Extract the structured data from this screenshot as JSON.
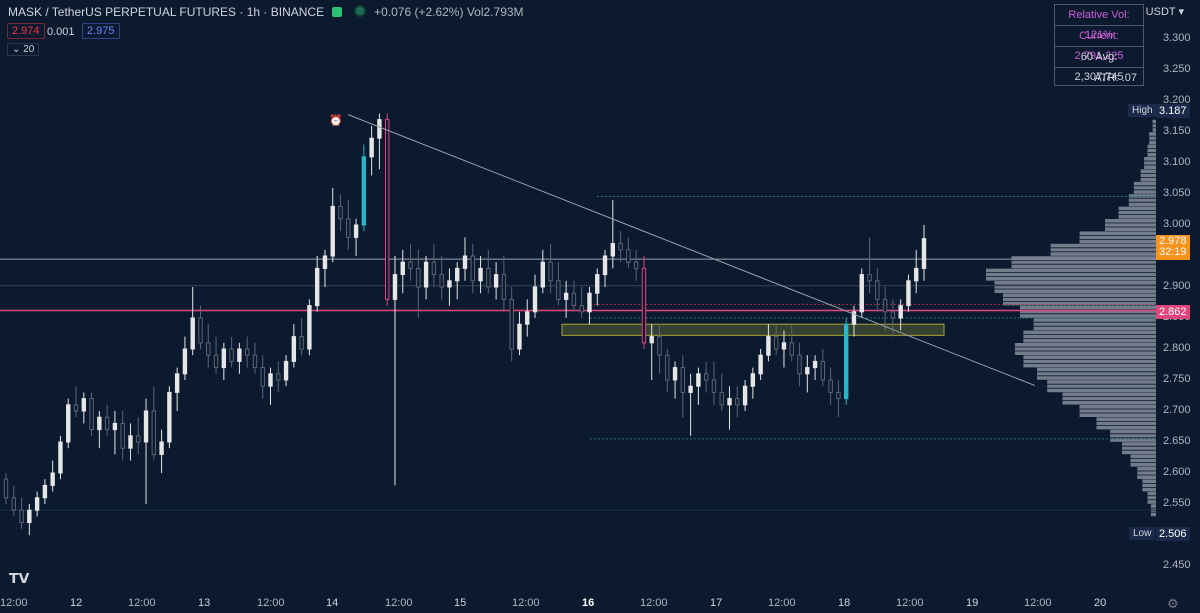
{
  "header": {
    "symbol": "MASK / TetherUS PERPETUAL FUTURES · 1h · BINANCE",
    "change": "+0.076 (+2.62%)",
    "vol_label": "Vol",
    "vol_value": "2.793M",
    "bid": "2.974",
    "spread": "0.001",
    "ask": "2.975",
    "indicator": "20"
  },
  "indicator_box": {
    "relative_vol": "Relative Vol: 121%",
    "current": "Current: 2,791,225",
    "avg": "60 Avg: 2,307,745",
    "atr": "ATR: .07"
  },
  "axis": {
    "currency": "USDT",
    "ticks": [
      "3.300",
      "3.250",
      "3.200",
      "3.150",
      "3.100",
      "3.050",
      "3.000",
      "2.950",
      "2.900",
      "2.850",
      "2.800",
      "2.750",
      "2.700",
      "2.650",
      "2.600",
      "2.550",
      "2.450"
    ],
    "x_labels": [
      "12:00",
      "12",
      "12:00",
      "13",
      "12:00",
      "14",
      "12:00",
      "15",
      "12:00",
      "16",
      "12:00",
      "17",
      "12:00",
      "18",
      "12:00",
      "19",
      "12:00",
      "20"
    ]
  },
  "badges": {
    "high_label": "High",
    "high_value": "3.187",
    "low_label": "Low",
    "low_value": "2.506",
    "current_price": "2.978",
    "countdown": "32:19",
    "red_line": "2.862"
  },
  "colors": {
    "background": "#0b1a2f",
    "up": "#e6e6e6",
    "down": "#5d6373",
    "bull_hl": "#26b5c9",
    "bear_hl": "#e0457b",
    "red_line": "#e0457b",
    "price_badge": "#f7931a",
    "zone": "#a7a436"
  },
  "chart_data": {
    "type": "candlestick",
    "price_range": [
      2.42,
      3.33
    ],
    "high": 3.187,
    "low": 2.506,
    "last": 2.978,
    "levels": {
      "white_line": 2.945,
      "red_line": 2.862,
      "faint_line": 2.902,
      "dotted_red": 2.872,
      "dotted_teal": 2.85,
      "top_teal": 3.046,
      "bottom_teal": 2.655,
      "supply_zone": [
        2.822,
        2.84
      ]
    },
    "trendline": {
      "from": [
        348,
        3.178
      ],
      "to": [
        1035,
        2.741
      ]
    },
    "candles": [
      [
        2.59,
        2.6,
        2.55,
        2.56
      ],
      [
        2.56,
        2.58,
        2.53,
        2.54
      ],
      [
        2.54,
        2.56,
        2.51,
        2.52
      ],
      [
        2.52,
        2.55,
        2.5,
        2.54
      ],
      [
        2.54,
        2.57,
        2.53,
        2.56
      ],
      [
        2.56,
        2.59,
        2.55,
        2.58
      ],
      [
        2.58,
        2.62,
        2.57,
        2.6
      ],
      [
        2.6,
        2.66,
        2.59,
        2.65
      ],
      [
        2.65,
        2.72,
        2.64,
        2.71
      ],
      [
        2.71,
        2.74,
        2.69,
        2.7
      ],
      [
        2.7,
        2.73,
        2.68,
        2.72
      ],
      [
        2.72,
        2.73,
        2.66,
        2.67
      ],
      [
        2.67,
        2.7,
        2.64,
        2.69
      ],
      [
        2.69,
        2.71,
        2.66,
        2.67
      ],
      [
        2.67,
        2.7,
        2.63,
        2.68
      ],
      [
        2.68,
        2.7,
        2.62,
        2.64
      ],
      [
        2.64,
        2.68,
        2.62,
        2.66
      ],
      [
        2.66,
        2.69,
        2.63,
        2.65
      ],
      [
        2.65,
        2.72,
        2.55,
        2.7
      ],
      [
        2.7,
        2.74,
        2.62,
        2.63
      ],
      [
        2.63,
        2.67,
        2.6,
        2.65
      ],
      [
        2.65,
        2.74,
        2.64,
        2.73
      ],
      [
        2.73,
        2.77,
        2.7,
        2.76
      ],
      [
        2.76,
        2.82,
        2.75,
        2.8
      ],
      [
        2.8,
        2.9,
        2.79,
        2.85
      ],
      [
        2.85,
        2.87,
        2.8,
        2.81
      ],
      [
        2.81,
        2.84,
        2.77,
        2.79
      ],
      [
        2.79,
        2.82,
        2.76,
        2.77
      ],
      [
        2.77,
        2.81,
        2.75,
        2.8
      ],
      [
        2.8,
        2.82,
        2.77,
        2.78
      ],
      [
        2.78,
        2.81,
        2.76,
        2.8
      ],
      [
        2.8,
        2.82,
        2.77,
        2.79
      ],
      [
        2.79,
        2.81,
        2.76,
        2.77
      ],
      [
        2.77,
        2.79,
        2.72,
        2.74
      ],
      [
        2.74,
        2.77,
        2.71,
        2.76
      ],
      [
        2.76,
        2.78,
        2.73,
        2.75
      ],
      [
        2.75,
        2.79,
        2.74,
        2.78
      ],
      [
        2.78,
        2.84,
        2.77,
        2.82
      ],
      [
        2.82,
        2.85,
        2.79,
        2.8
      ],
      [
        2.8,
        2.88,
        2.79,
        2.87
      ],
      [
        2.87,
        2.95,
        2.86,
        2.93
      ],
      [
        2.93,
        2.96,
        2.9,
        2.95
      ],
      [
        2.95,
        3.06,
        2.94,
        3.03
      ],
      [
        3.03,
        3.05,
        2.99,
        3.01
      ],
      [
        3.01,
        3.04,
        2.96,
        2.98
      ],
      [
        2.98,
        3.01,
        2.95,
        3.0
      ],
      [
        3.0,
        3.13,
        2.99,
        3.11
      ],
      [
        3.11,
        3.16,
        3.08,
        3.14
      ],
      [
        3.14,
        3.18,
        3.09,
        3.17
      ],
      [
        3.17,
        3.18,
        2.87,
        2.88
      ],
      [
        2.88,
        2.95,
        2.58,
        2.92
      ],
      [
        2.92,
        2.96,
        2.89,
        2.94
      ],
      [
        2.94,
        2.97,
        2.91,
        2.93
      ],
      [
        2.93,
        2.96,
        2.85,
        2.9
      ],
      [
        2.9,
        2.95,
        2.88,
        2.94
      ],
      [
        2.94,
        2.97,
        2.9,
        2.92
      ],
      [
        2.92,
        2.95,
        2.88,
        2.9
      ],
      [
        2.9,
        2.93,
        2.87,
        2.91
      ],
      [
        2.91,
        2.94,
        2.88,
        2.93
      ],
      [
        2.93,
        2.98,
        2.91,
        2.95
      ],
      [
        2.95,
        2.97,
        2.89,
        2.91
      ],
      [
        2.91,
        2.95,
        2.89,
        2.93
      ],
      [
        2.93,
        2.96,
        2.89,
        2.9
      ],
      [
        2.9,
        2.94,
        2.88,
        2.92
      ],
      [
        2.92,
        2.95,
        2.86,
        2.88
      ],
      [
        2.88,
        2.9,
        2.78,
        2.8
      ],
      [
        2.8,
        2.86,
        2.79,
        2.84
      ],
      [
        2.84,
        2.88,
        2.82,
        2.86
      ],
      [
        2.86,
        2.92,
        2.85,
        2.9
      ],
      [
        2.9,
        2.96,
        2.89,
        2.94
      ],
      [
        2.94,
        2.97,
        2.89,
        2.91
      ],
      [
        2.91,
        2.94,
        2.87,
        2.88
      ],
      [
        2.88,
        2.91,
        2.85,
        2.89
      ],
      [
        2.89,
        2.91,
        2.86,
        2.87
      ],
      [
        2.87,
        2.9,
        2.85,
        2.86
      ],
      [
        2.86,
        2.9,
        2.84,
        2.89
      ],
      [
        2.89,
        2.93,
        2.87,
        2.92
      ],
      [
        2.92,
        2.96,
        2.9,
        2.95
      ],
      [
        2.95,
        3.04,
        2.93,
        2.97
      ],
      [
        2.97,
        2.99,
        2.94,
        2.96
      ],
      [
        2.96,
        2.98,
        2.93,
        2.94
      ],
      [
        2.94,
        2.96,
        2.91,
        2.93
      ],
      [
        2.93,
        2.95,
        2.8,
        2.81
      ],
      [
        2.81,
        2.84,
        2.75,
        2.82
      ],
      [
        2.82,
        2.84,
        2.76,
        2.79
      ],
      [
        2.79,
        2.8,
        2.73,
        2.75
      ],
      [
        2.75,
        2.78,
        2.72,
        2.77
      ],
      [
        2.77,
        2.79,
        2.69,
        2.73
      ],
      [
        2.73,
        2.76,
        2.66,
        2.74
      ],
      [
        2.74,
        2.77,
        2.71,
        2.76
      ],
      [
        2.76,
        2.78,
        2.73,
        2.75
      ],
      [
        2.75,
        2.78,
        2.71,
        2.73
      ],
      [
        2.73,
        2.76,
        2.7,
        2.71
      ],
      [
        2.71,
        2.74,
        2.67,
        2.72
      ],
      [
        2.72,
        2.74,
        2.69,
        2.71
      ],
      [
        2.71,
        2.75,
        2.7,
        2.74
      ],
      [
        2.74,
        2.77,
        2.72,
        2.76
      ],
      [
        2.76,
        2.8,
        2.75,
        2.79
      ],
      [
        2.79,
        2.84,
        2.78,
        2.82
      ],
      [
        2.82,
        2.84,
        2.79,
        2.8
      ],
      [
        2.8,
        2.83,
        2.77,
        2.81
      ],
      [
        2.81,
        2.84,
        2.78,
        2.79
      ],
      [
        2.79,
        2.81,
        2.74,
        2.76
      ],
      [
        2.76,
        2.79,
        2.73,
        2.77
      ],
      [
        2.77,
        2.79,
        2.75,
        2.78
      ],
      [
        2.78,
        2.8,
        2.74,
        2.75
      ],
      [
        2.75,
        2.77,
        2.71,
        2.73
      ],
      [
        2.73,
        2.75,
        2.69,
        2.72
      ],
      [
        2.72,
        2.85,
        2.71,
        2.84
      ],
      [
        2.84,
        2.87,
        2.82,
        2.86
      ],
      [
        2.86,
        2.93,
        2.85,
        2.92
      ],
      [
        2.92,
        2.98,
        2.89,
        2.91
      ],
      [
        2.91,
        2.93,
        2.86,
        2.88
      ],
      [
        2.88,
        2.9,
        2.83,
        2.86
      ],
      [
        2.86,
        2.88,
        2.82,
        2.85
      ],
      [
        2.85,
        2.88,
        2.83,
        2.87
      ],
      [
        2.87,
        2.92,
        2.86,
        2.91
      ],
      [
        2.91,
        2.96,
        2.89,
        2.93
      ],
      [
        2.93,
        3.0,
        2.91,
        2.978
      ]
    ],
    "volume_profile": [
      [
        3.16,
        0.02
      ],
      [
        3.14,
        0.04
      ],
      [
        3.12,
        0.05
      ],
      [
        3.1,
        0.07
      ],
      [
        3.08,
        0.09
      ],
      [
        3.06,
        0.13
      ],
      [
        3.04,
        0.16
      ],
      [
        3.02,
        0.22
      ],
      [
        3.0,
        0.3
      ],
      [
        2.98,
        0.45
      ],
      [
        2.96,
        0.62
      ],
      [
        2.94,
        0.85
      ],
      [
        2.92,
        1.0
      ],
      [
        2.9,
        0.95
      ],
      [
        2.88,
        0.9
      ],
      [
        2.86,
        0.8
      ],
      [
        2.84,
        0.72
      ],
      [
        2.82,
        0.78
      ],
      [
        2.8,
        0.83
      ],
      [
        2.78,
        0.78
      ],
      [
        2.76,
        0.7
      ],
      [
        2.74,
        0.64
      ],
      [
        2.72,
        0.55
      ],
      [
        2.7,
        0.45
      ],
      [
        2.68,
        0.35
      ],
      [
        2.66,
        0.27
      ],
      [
        2.64,
        0.2
      ],
      [
        2.62,
        0.15
      ],
      [
        2.6,
        0.11
      ],
      [
        2.58,
        0.08
      ],
      [
        2.56,
        0.05
      ],
      [
        2.54,
        0.03
      ]
    ]
  }
}
